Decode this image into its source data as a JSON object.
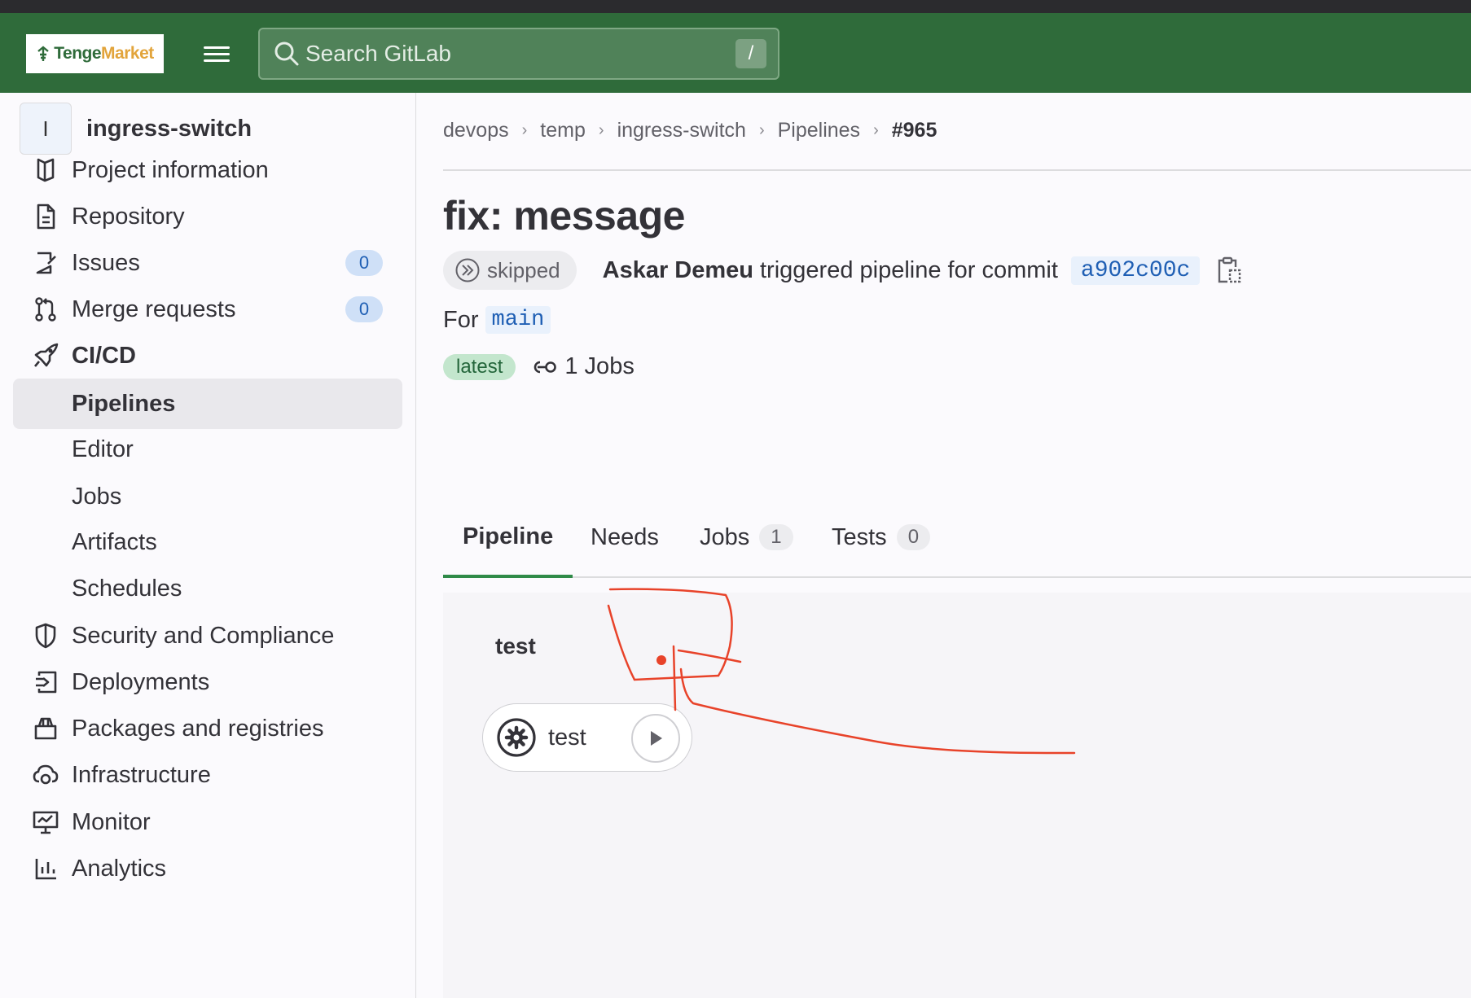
{
  "header": {
    "logo_part1": "Tenge",
    "logo_part2": "Market",
    "search_placeholder": "Search GitLab",
    "search_shortcut": "/"
  },
  "sidebar": {
    "project_initial": "I",
    "project_name": "ingress-switch",
    "items": [
      {
        "label": "Project information",
        "icon": "book-icon"
      },
      {
        "label": "Repository",
        "icon": "document-icon"
      },
      {
        "label": "Issues",
        "icon": "issues-icon",
        "badge": "0"
      },
      {
        "label": "Merge requests",
        "icon": "merge-request-icon",
        "badge": "0"
      },
      {
        "label": "CI/CD",
        "icon": "rocket-icon"
      },
      {
        "label": "Pipelines"
      },
      {
        "label": "Editor"
      },
      {
        "label": "Jobs"
      },
      {
        "label": "Artifacts"
      },
      {
        "label": "Schedules"
      },
      {
        "label": "Security and Compliance",
        "icon": "shield-icon"
      },
      {
        "label": "Deployments",
        "icon": "deployments-icon"
      },
      {
        "label": "Packages and registries",
        "icon": "package-icon"
      },
      {
        "label": "Infrastructure",
        "icon": "cloud-gear-icon"
      },
      {
        "label": "Monitor",
        "icon": "monitor-icon"
      },
      {
        "label": "Analytics",
        "icon": "chart-icon"
      }
    ]
  },
  "breadcrumb": [
    "devops",
    "temp",
    "ingress-switch",
    "Pipelines",
    "#965"
  ],
  "pipeline": {
    "title": "fix: message",
    "status": "skipped",
    "author": "Askar Demeu",
    "trigger_text": "triggered pipeline for commit",
    "commit_sha": "a902c00c",
    "for_label": "For",
    "branch": "main",
    "tag": "latest",
    "jobs_summary": "1 Jobs"
  },
  "tabs": [
    {
      "label": "Pipeline"
    },
    {
      "label": "Needs"
    },
    {
      "label": "Jobs",
      "count": "1"
    },
    {
      "label": "Tests",
      "count": "0"
    }
  ],
  "graph": {
    "stage_name": "test",
    "job_name": "test",
    "job_status_icon": "gear-icon",
    "job_action_icon": "play-icon"
  },
  "colors": {
    "navbar": "#2f6b3a",
    "accent": "#2f8a48",
    "link": "#1f5fb4",
    "annotation": "#e8432a"
  }
}
